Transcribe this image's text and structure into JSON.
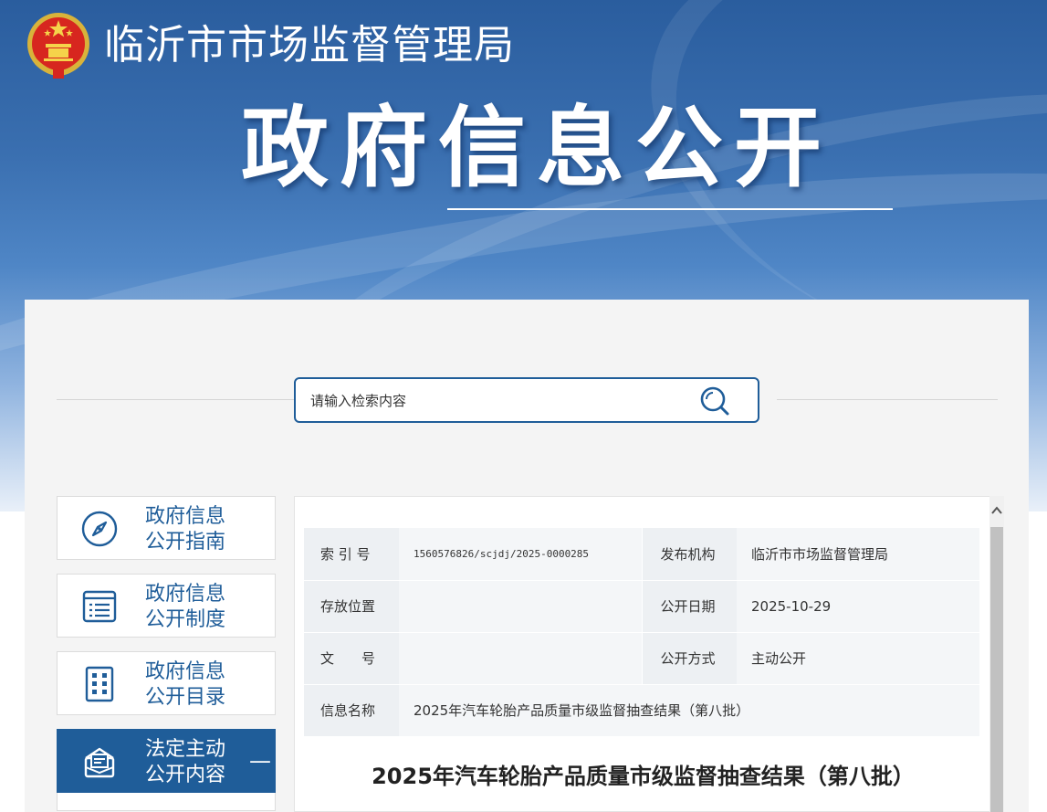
{
  "header": {
    "site_name": "临沂市市场监督管理局",
    "hero_title": "政府信息公开"
  },
  "search": {
    "placeholder": "请输入检索内容",
    "icon": "search-icon"
  },
  "sidebar": {
    "items": [
      {
        "label_line1": "政府信息",
        "label_line2": "公开指南",
        "icon": "compass-icon",
        "active": false
      },
      {
        "label_line1": "政府信息",
        "label_line2": "公开制度",
        "icon": "document-list-icon",
        "active": false
      },
      {
        "label_line1": "政府信息",
        "label_line2": "公开目录",
        "icon": "catalog-grid-icon",
        "active": false
      },
      {
        "label_line1": "法定主动",
        "label_line2": "公开内容",
        "icon": "newspaper-icon",
        "active": true,
        "toggle": "—"
      }
    ]
  },
  "meta": {
    "index_label": "索 引 号",
    "index_value": "1560576826/scjdj/2025-0000285",
    "publisher_label": "发布机构",
    "publisher_value": "临沂市市场监督管理局",
    "location_label": "存放位置",
    "location_value": "",
    "date_label": "公开日期",
    "date_value": "2025-10-29",
    "docno_label": "文　　号",
    "docno_value": "",
    "mode_label": "公开方式",
    "mode_value": "主动公开",
    "name_label": "信息名称",
    "name_value": "2025年汽车轮胎产品质量市级监督抽查结果（第八批）"
  },
  "article": {
    "title": "2025年汽车轮胎产品质量市级监督抽查结果（第八批）"
  },
  "colors": {
    "brand": "#1f5d99",
    "banner_top": "#2a5d9e",
    "panel_bg": "#f4f4f4"
  }
}
